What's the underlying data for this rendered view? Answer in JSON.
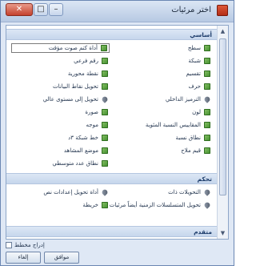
{
  "window": {
    "title": "اختر مرئيات",
    "close_glyph": "✕",
    "maximize_glyph": "□",
    "minimize_glyph": "–"
  },
  "groups": [
    {
      "label": "أساسي"
    },
    {
      "label": "تحكم"
    },
    {
      "label": "متقدم"
    }
  ],
  "basic_right": [
    {
      "label": "سطح",
      "icon": "grid-icon"
    },
    {
      "label": "شبكة",
      "icon": "grid-icon"
    },
    {
      "label": "تقسيم",
      "icon": "grid-icon"
    },
    {
      "label": "حرف",
      "icon": "grid-icon"
    },
    {
      "label": "الترميز الداخلي",
      "icon": "wrench-icon"
    },
    {
      "label": "لون",
      "icon": "grid-icon"
    },
    {
      "label": "المقاييس النسبة المئوية",
      "icon": "grid-icon"
    },
    {
      "label": "نطاق نسبة",
      "icon": "grid-icon"
    },
    {
      "label": "قيم ملاح",
      "icon": "grid-icon"
    }
  ],
  "basic_left": [
    {
      "label": "أداة كتم صوت مؤقت",
      "icon": "grid-icon",
      "selected": true
    },
    {
      "label": "رقم فرعي",
      "icon": "grid-icon"
    },
    {
      "label": "نقطة محورية",
      "icon": "grid-icon"
    },
    {
      "label": "تحويل نقاط البيانات",
      "icon": "grid-icon"
    },
    {
      "label": "تحويل إلى مستوى عالي",
      "icon": "wrench-icon"
    },
    {
      "label": "صورة",
      "icon": "grid-icon"
    },
    {
      "label": "موجه",
      "icon": "grid-icon"
    },
    {
      "label": "خط شبكة ٣د",
      "icon": "grid-icon"
    },
    {
      "label": "موضع المشاهد",
      "icon": "grid-icon"
    },
    {
      "label": "نطاق عدد متوسطي",
      "icon": "grid-icon"
    }
  ],
  "control_right": [
    {
      "label": "التحويلات ذات",
      "icon": "wrench-icon"
    },
    {
      "label": "تحويل المتسلسلات الزمنية أيضاً مرئيات",
      "icon": "wrench-icon"
    }
  ],
  "control_left": [
    {
      "label": "أداة تحويل إعدادات نص",
      "icon": "wrench-icon"
    },
    {
      "label": "خريطة",
      "icon": "grid-icon"
    }
  ],
  "footer": {
    "checkbox_label": "إدراج مخطط",
    "ok_label": "موافق",
    "cancel_label": "إلغاء"
  }
}
